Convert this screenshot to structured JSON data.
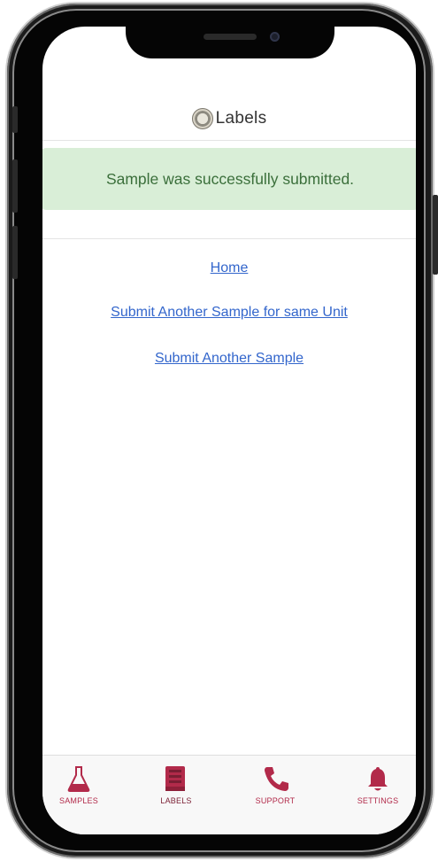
{
  "header": {
    "title": "Labels",
    "logo_icon": "company-seal-icon"
  },
  "banner": {
    "message": "Sample was successfully submitted.",
    "bg_color": "#d9eed7",
    "text_color": "#3b6f3b"
  },
  "links": {
    "home": "Home",
    "same_unit": "Submit Another Sample for same Unit",
    "another": "Submit Another Sample"
  },
  "tabs": [
    {
      "label": "SAMPLES",
      "icon": "flask-icon",
      "active": false
    },
    {
      "label": "LABELS",
      "icon": "document-icon",
      "active": true
    },
    {
      "label": "SUPPORT",
      "icon": "phone-icon",
      "active": false
    },
    {
      "label": "SETTINGS",
      "icon": "bell-icon",
      "active": false
    }
  ],
  "colors": {
    "accent": "#b22a4a",
    "link": "#3366cc"
  }
}
